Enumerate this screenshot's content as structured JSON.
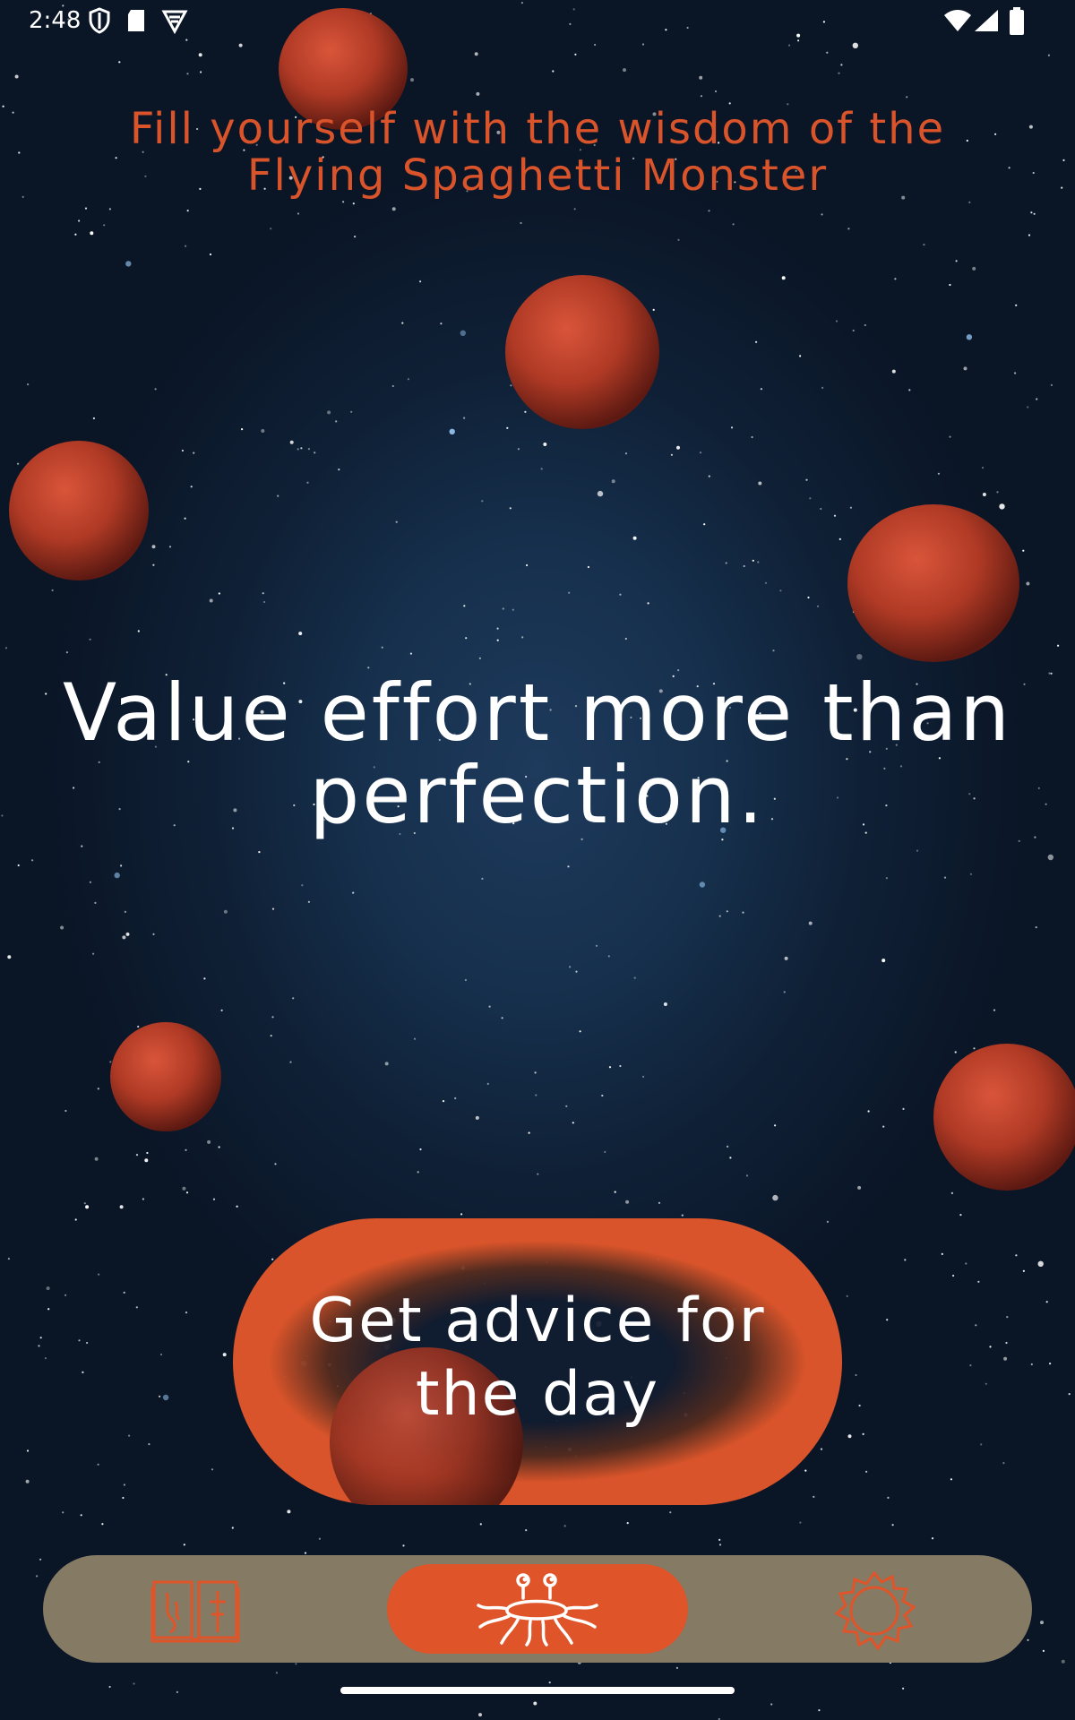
{
  "status_bar": {
    "time": "2:48",
    "icons": [
      "shield-icon",
      "sd-card-icon",
      "vpn-icon",
      "wifi-icon",
      "signal-icon",
      "battery-icon"
    ]
  },
  "header": {
    "title_line1": "Fill yourself with the wisdom of the",
    "title_line2": "Flying Spaghetti Monster"
  },
  "main": {
    "quote_line1": "Value effort more than",
    "quote_line2": "perfection."
  },
  "advice_button": {
    "line1": "Get advice for",
    "line2": "the day"
  },
  "bottom_nav": {
    "items": [
      {
        "icon": "book-icon",
        "active": false
      },
      {
        "icon": "spaghetti-monster-icon",
        "active": true
      },
      {
        "icon": "gear-icon",
        "active": false
      }
    ]
  },
  "colors": {
    "accent": "#e0542a",
    "title": "#d9542a",
    "nav_bar": "#857a63",
    "background": "#12263f"
  }
}
